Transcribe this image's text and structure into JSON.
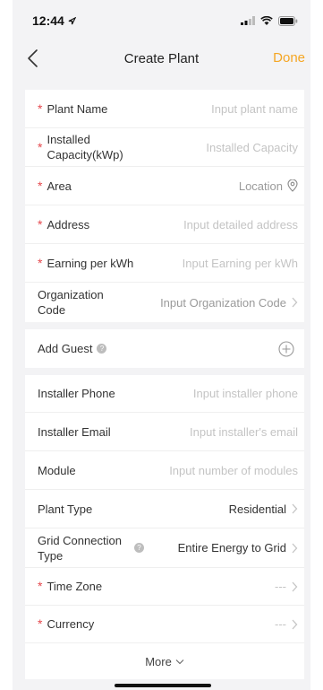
{
  "status": {
    "time": "12:44"
  },
  "nav": {
    "title": "Create Plant",
    "done": "Done"
  },
  "required_mark": "*",
  "section1": [
    {
      "label": "Plant Name",
      "required": true,
      "placeholder": "Input plant name"
    },
    {
      "label": "Installed Capacity(kWp)",
      "required": true,
      "placeholder": "Installed Capacity"
    },
    {
      "label": "Area",
      "required": true,
      "placeholder": "Location"
    },
    {
      "label": "Address",
      "required": true,
      "placeholder": "Input detailed address"
    },
    {
      "label": "Earning per kWh",
      "required": true,
      "placeholder": "Input Earning per kWh"
    },
    {
      "label": "Organization Code",
      "required": false,
      "placeholder": "Input Organization Code"
    }
  ],
  "guest": {
    "label": "Add Guest"
  },
  "section3": [
    {
      "label": "Installer Phone",
      "placeholder": "Input installer phone"
    },
    {
      "label": "Installer Email",
      "placeholder": "Input installer's email"
    },
    {
      "label": "Module",
      "placeholder": "Input number of modules"
    },
    {
      "label": "Plant Type",
      "value": "Residential"
    },
    {
      "label": "Grid Connection Type",
      "value": "Entire Energy to Grid"
    },
    {
      "label": "Time Zone",
      "required": true,
      "value": "---"
    },
    {
      "label": "Currency",
      "required": true,
      "value": "---"
    }
  ],
  "more": "More",
  "colors": {
    "accent": "#f5a623",
    "required": "#e5484d",
    "background": "#f3f3f5"
  }
}
